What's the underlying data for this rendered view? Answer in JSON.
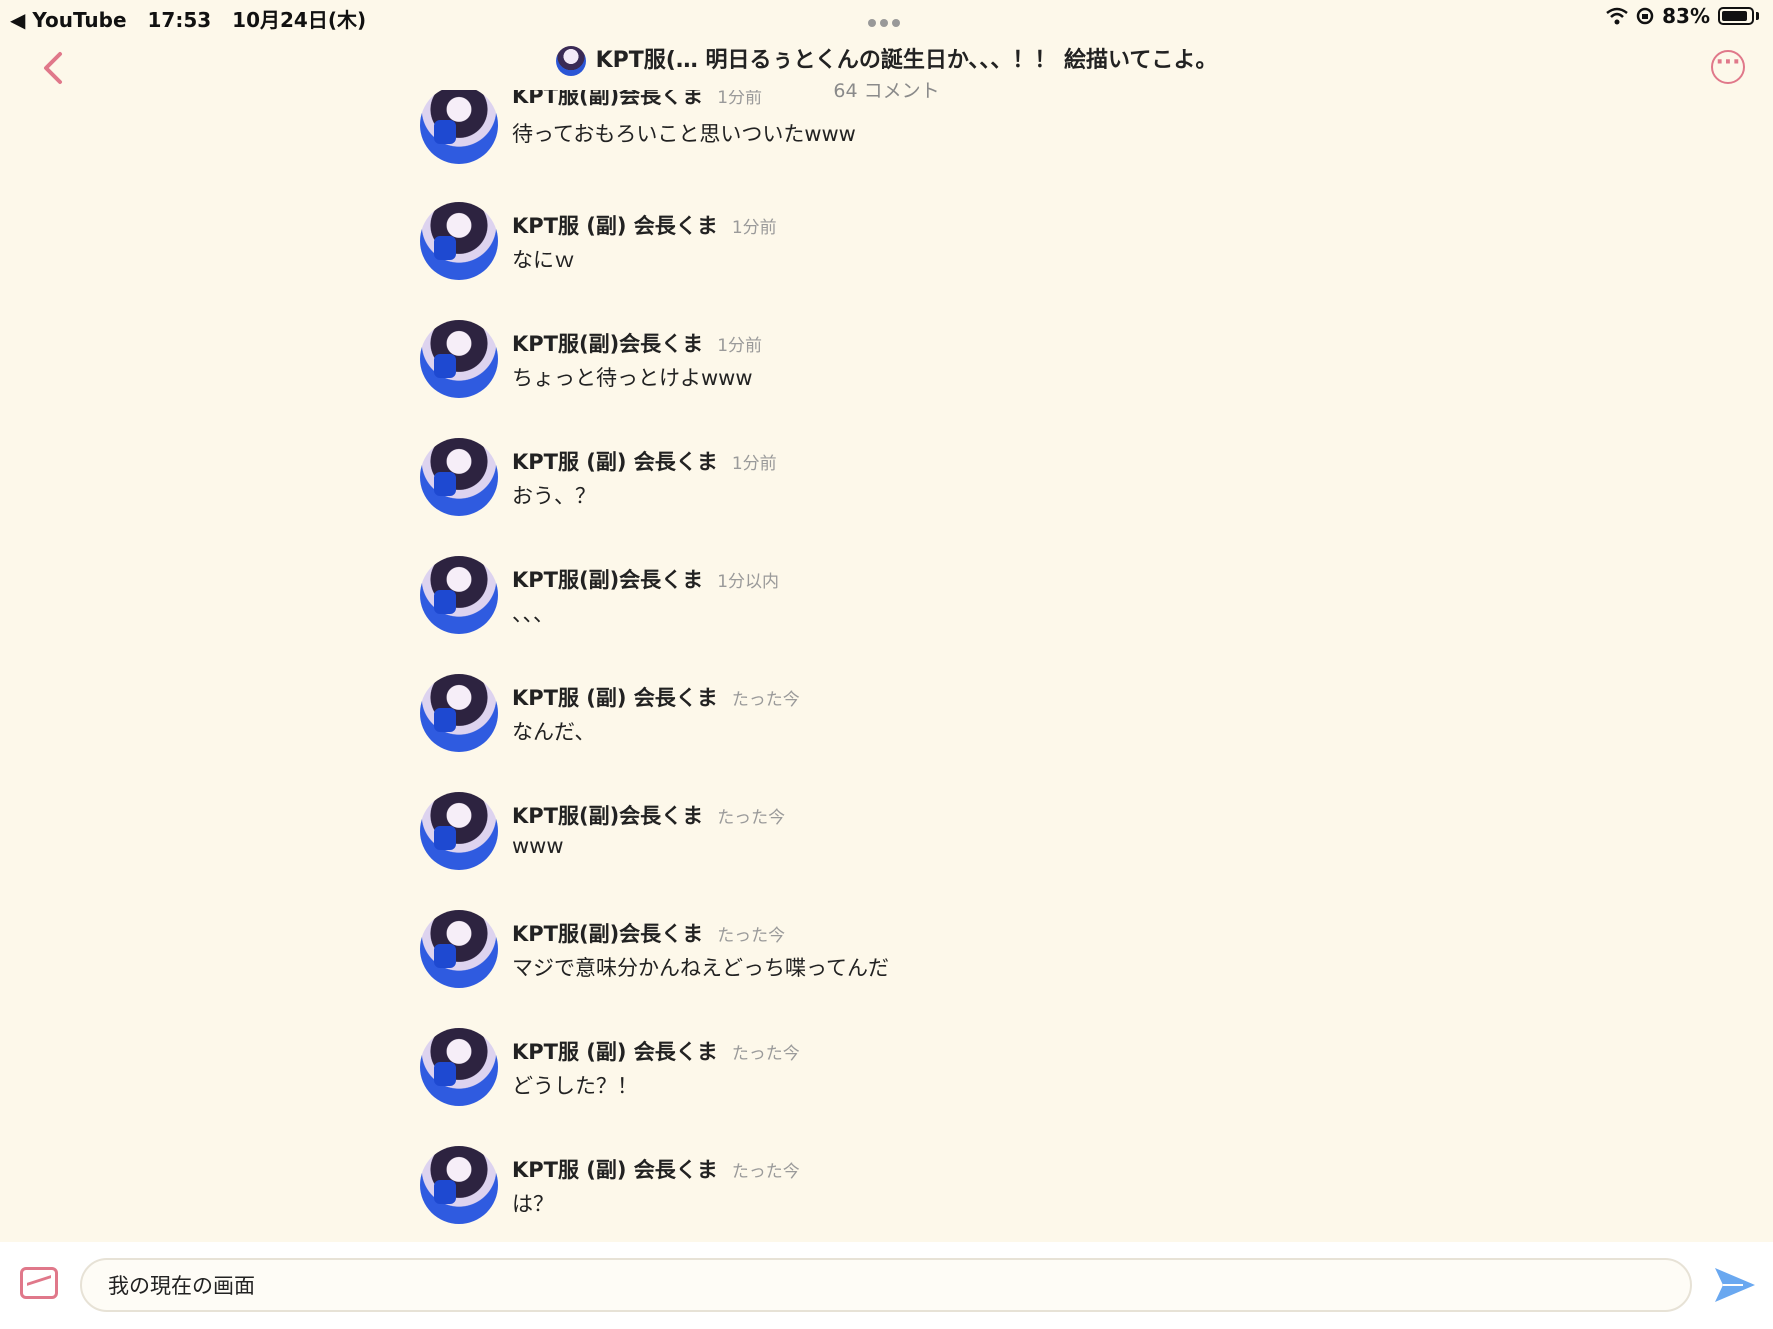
{
  "status_bar": {
    "back_app": "◀ YouTube",
    "time": "17:53",
    "date": "10月24日(木)",
    "battery": "83%"
  },
  "header": {
    "title": "KPT服(… 明日るぅとくんの誕生日か、、、！！ 絵描いてこよ。",
    "subtitle": "64 コメント"
  },
  "messages": [
    {
      "name": "KPT服(副)会長くま",
      "time": "1分前",
      "text": "待っておもろいこと思いついたwww"
    },
    {
      "name": "KPT服 (副) 会長くま",
      "time": "1分前",
      "text": "なにｗ"
    },
    {
      "name": "KPT服(副)会長くま",
      "time": "1分前",
      "text": "ちょっと待っとけよwww"
    },
    {
      "name": "KPT服 (副) 会長くま",
      "time": "1分前",
      "text": "おう、？"
    },
    {
      "name": "KPT服(副)会長くま",
      "time": "1分以内",
      "text": "、、、"
    },
    {
      "name": "KPT服 (副) 会長くま",
      "time": "たった今",
      "text": "なんだ、"
    },
    {
      "name": "KPT服(副)会長くま",
      "time": "たった今",
      "text": "www"
    },
    {
      "name": "KPT服(副)会長くま",
      "time": "たった今",
      "text": "マジで意味分かんねえどっち喋ってんだ"
    },
    {
      "name": "KPT服 (副) 会長くま",
      "time": "たった今",
      "text": "どうした？！"
    },
    {
      "name": "KPT服 (副) 会長くま",
      "time": "たった今",
      "text": "は？"
    }
  ],
  "input": {
    "value": "我の現在の画面"
  },
  "colors": {
    "accent": "#e0788a",
    "send": "#6aa8f0",
    "background": "#fdf8ea"
  }
}
